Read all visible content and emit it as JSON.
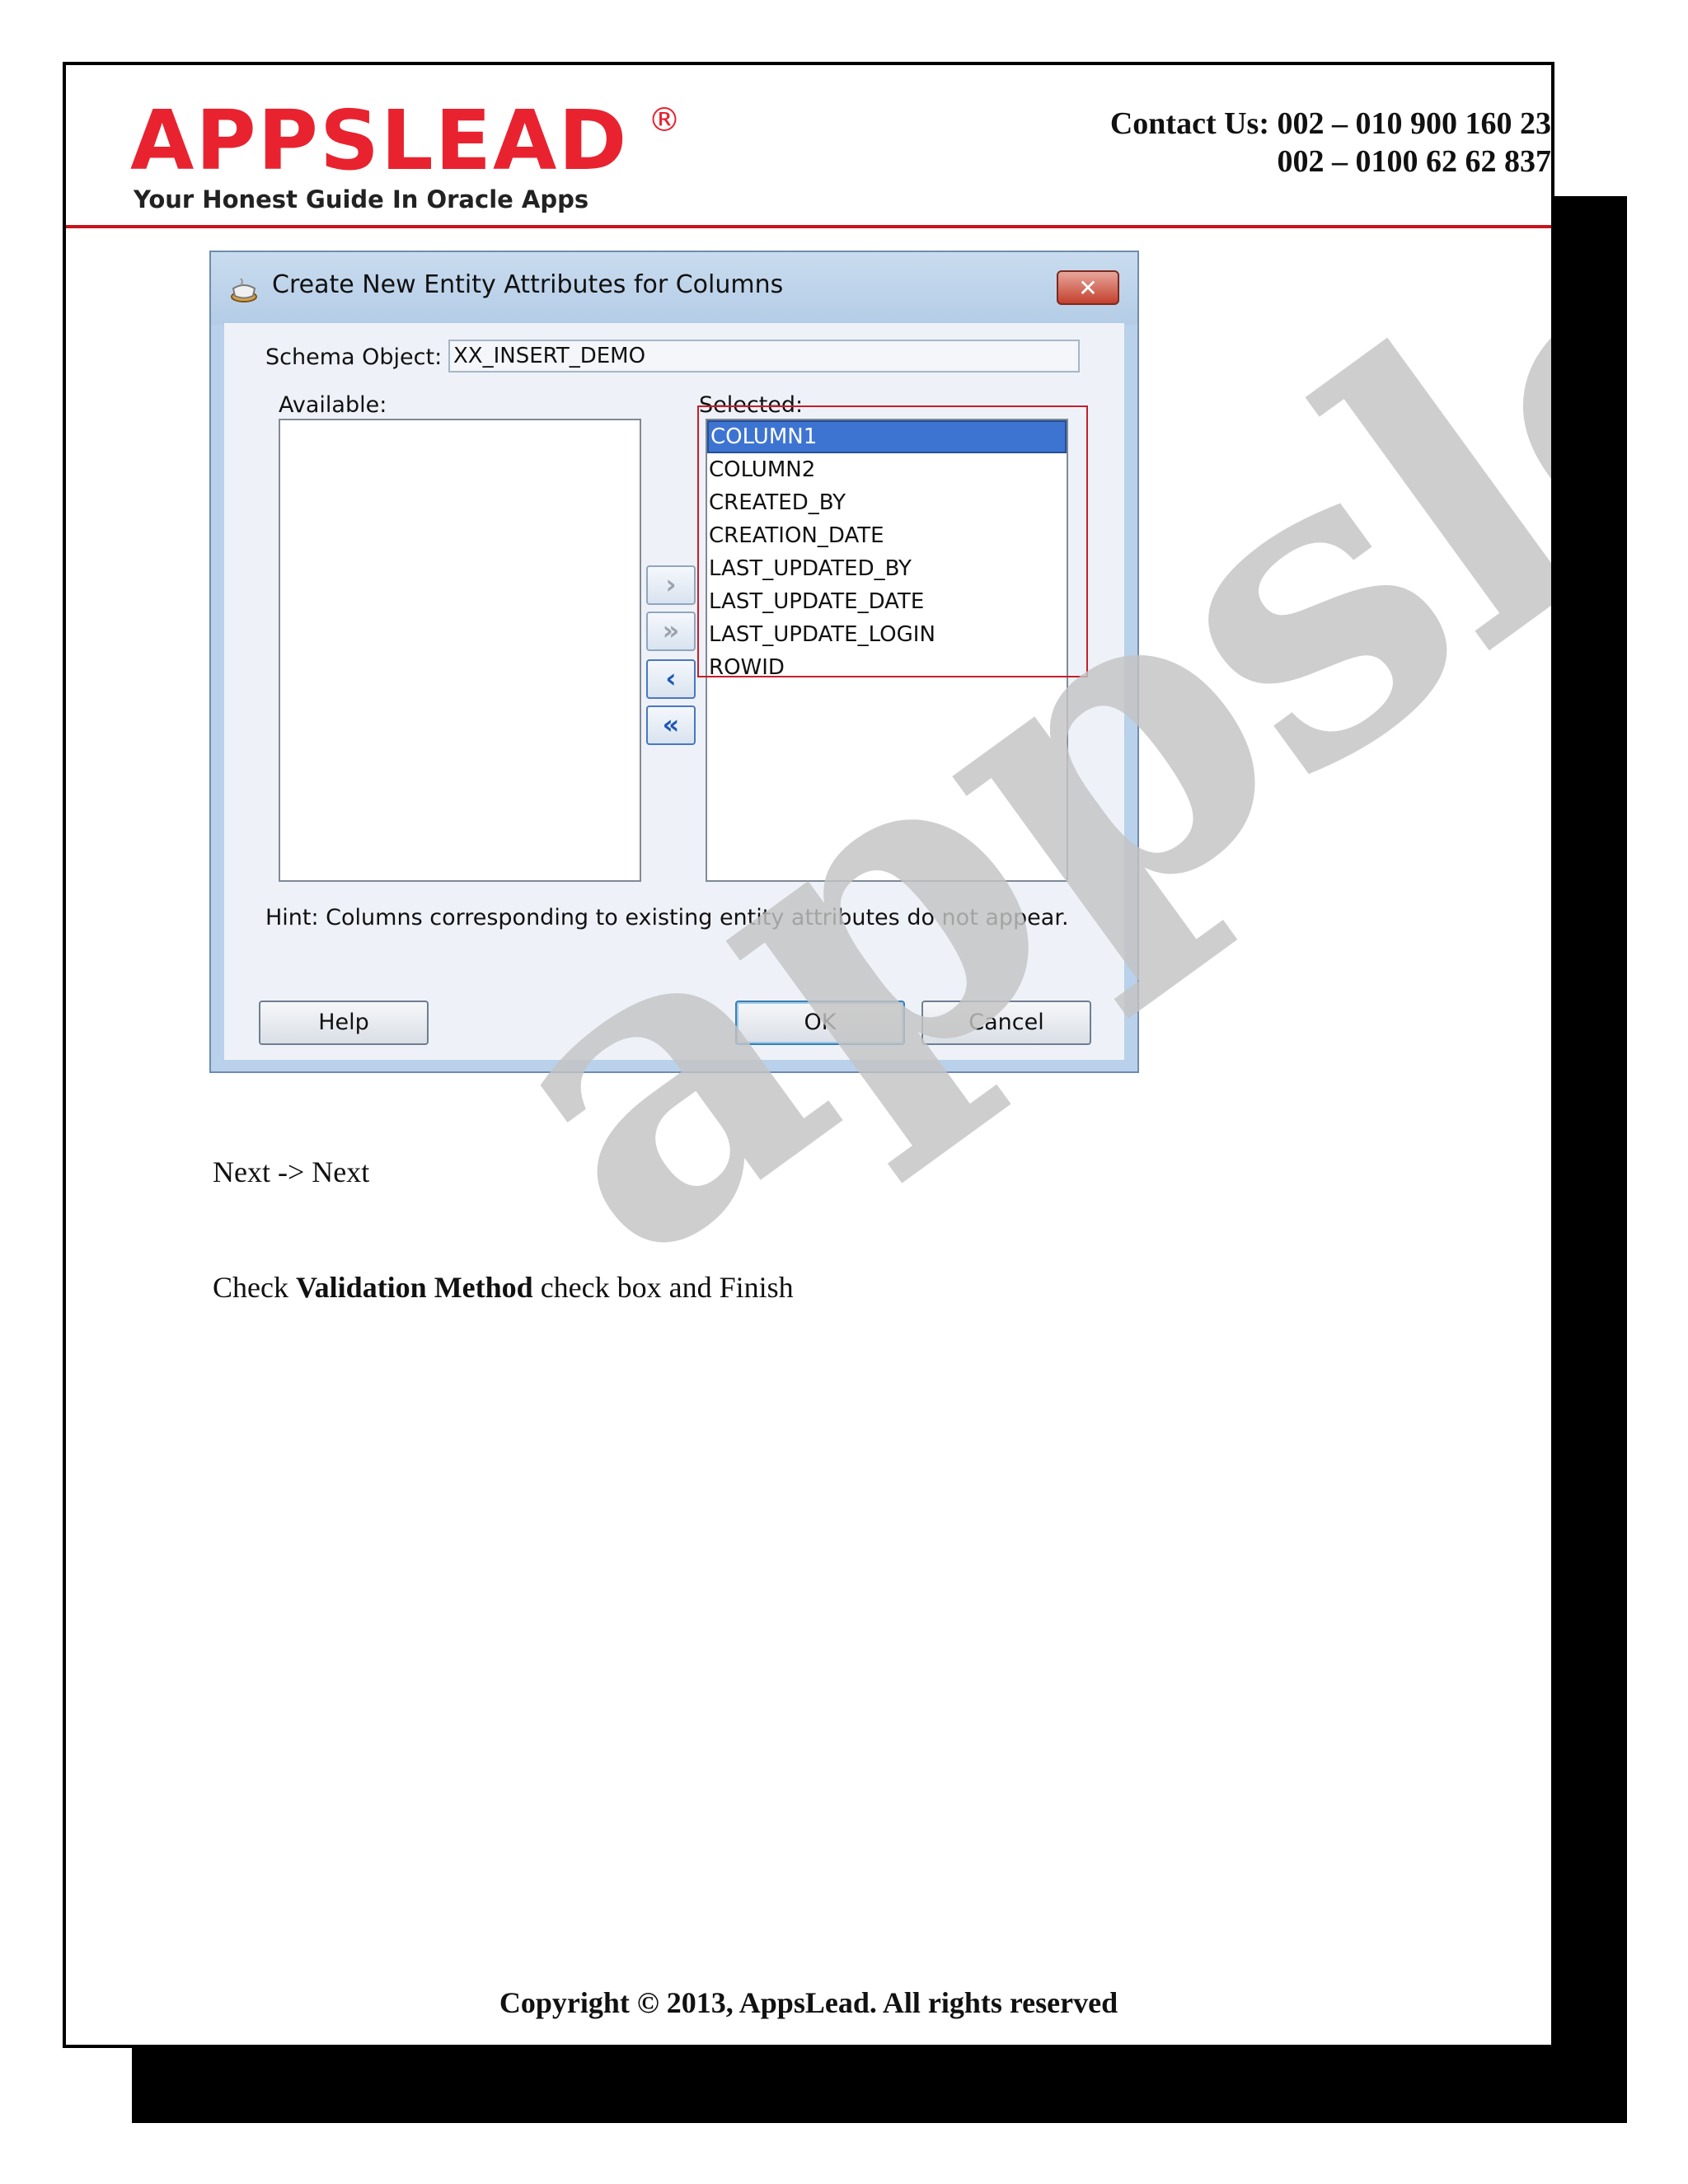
{
  "header": {
    "logo_text": "APPSLEAD",
    "logo_registered": "®",
    "logo_tagline": "Your Honest Guide In Oracle Apps",
    "contact_line1": "Contact Us: 002 – 010 900 160 23",
    "contact_line2": "002 – 0100 62 62 837",
    "accent_color": "#e8232f"
  },
  "watermark": "appslead",
  "dialog": {
    "title": "Create New Entity Attributes for Columns",
    "close_label": "✕",
    "schema_label": "Schema Object:",
    "schema_value": "XX_INSERT_DEMO",
    "available_label": "Available:",
    "selected_label": "Selected:",
    "available_items": [],
    "selected_items": [
      "COLUMN1",
      "COLUMN2",
      "CREATED_BY",
      "CREATION_DATE",
      "LAST_UPDATED_BY",
      "LAST_UPDATE_DATE",
      "LAST_UPDATE_LOGIN",
      "ROWID"
    ],
    "selected_index": 0,
    "hint": "Hint: Columns corresponding to existing entity attributes do not appear.",
    "help_label": "Help",
    "ok_label": "OK",
    "cancel_label": "Cancel"
  },
  "body": {
    "line1": "Next -> Next",
    "line2_prefix": "Check ",
    "line2_bold": "Validation Method",
    "line2_suffix": " check box and Finish"
  },
  "footer": "Copyright © 2013, AppsLead. All rights reserved"
}
